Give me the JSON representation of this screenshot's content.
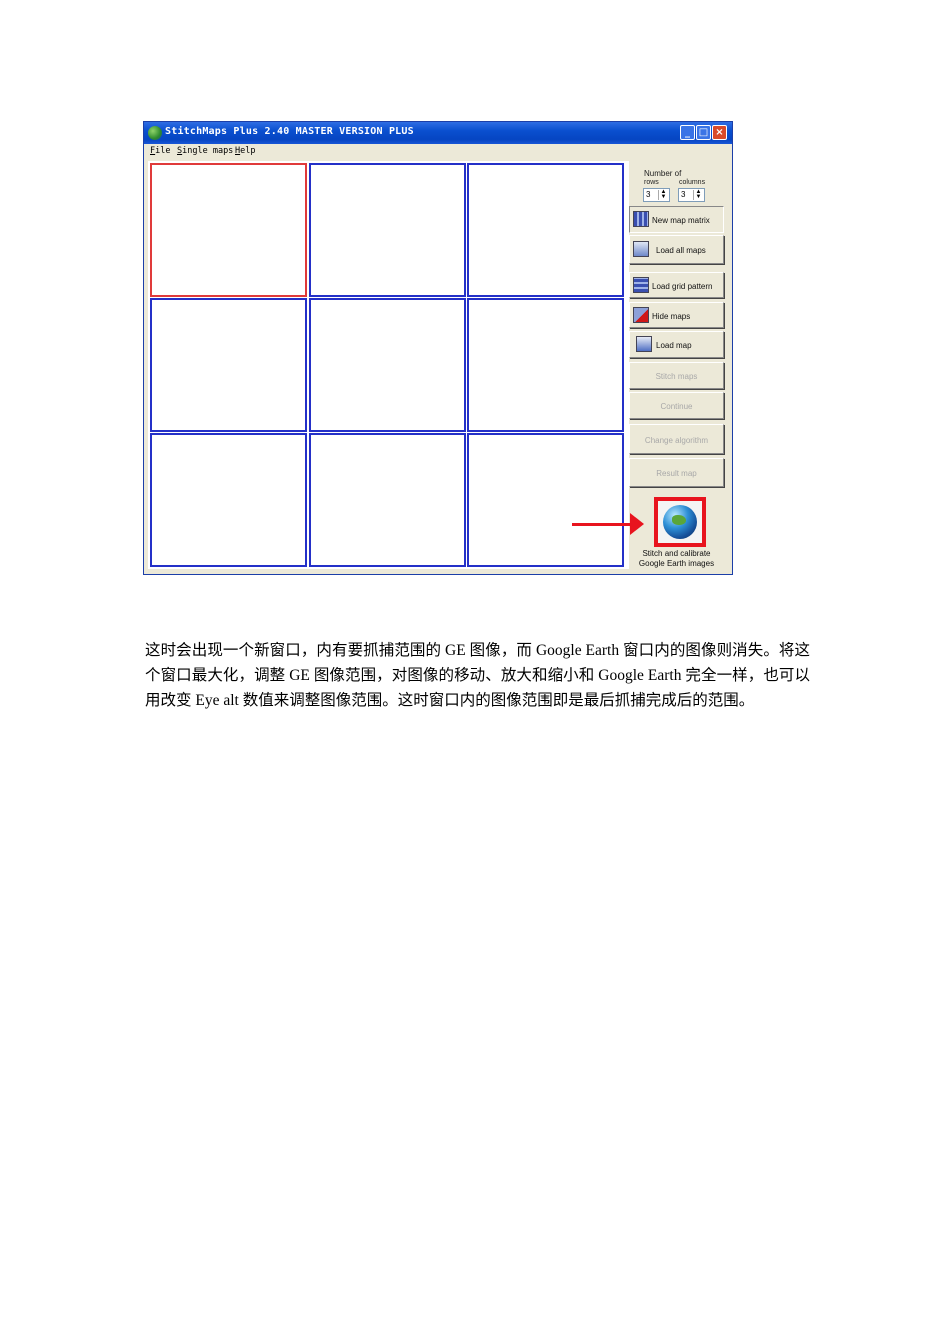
{
  "window": {
    "title": "StitchMaps Plus 2.40 MASTER VERSION PLUS",
    "menu": [
      {
        "accel": "F",
        "rest": "ile"
      },
      {
        "accel": "S",
        "rest": "ingle maps"
      },
      {
        "accel": "H",
        "rest": "elp"
      }
    ]
  },
  "matrix": {
    "rows": 3,
    "columns": 3,
    "active_cell": "1,1"
  },
  "panel": {
    "number_of_label": "Number of",
    "rows_label": "rows",
    "columns_label": "columns",
    "rows_value": "3",
    "columns_value": "3",
    "buttons": {
      "new_map_matrix": "New map matrix",
      "load_all_maps": "Load all maps",
      "load_grid_pattern": "Load grid pattern",
      "hide_maps": "Hide maps",
      "load_map": "Load map",
      "stitch_maps": "Stitch maps",
      "continue": "Continue",
      "change_algorithm": "Change algorithm",
      "result_map": "Result map"
    },
    "ge_caption_line1": "Stitch and calibrate",
    "ge_caption_line2": "Google Earth images"
  },
  "colors": {
    "highlight": "#e8141e",
    "cell_border": "#2430c8",
    "active_cell_border": "#e03a3a"
  },
  "paragraph": "这时会出现一个新窗口，内有要抓捕范围的 GE 图像，而 Google Earth 窗口内的图像则消失。将这个窗口最大化，调整 GE 图像范围，对图像的移动、放大和缩小和 Google Earth 完全一样，也可以用改变 Eye alt  数值来调整图像范围。这时窗口内的图像范围即是最后抓捕完成后的范围。"
}
